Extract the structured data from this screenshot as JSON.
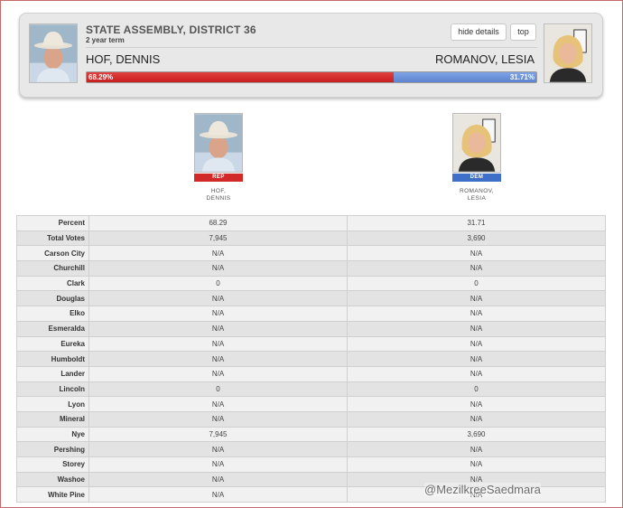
{
  "race": {
    "title": "STATE ASSEMBLY, DISTRICT 36",
    "term": "2 year term",
    "hide_details_label": "hide details",
    "top_label": "top"
  },
  "candidates": {
    "rep": {
      "name": "HOF, DENNIS",
      "name_line1": "HOF,",
      "name_line2": "DENNIS",
      "party": "REP",
      "percent": 68.29,
      "percent_label": "68.29%",
      "color": "#c71f1f"
    },
    "dem": {
      "name": "ROMANOV, LESIA",
      "name_line1": "ROMANOV,",
      "name_line2": "LESIA",
      "party": "DEM",
      "percent": 31.71,
      "percent_label": "31.71%",
      "color": "#5c84cf"
    }
  },
  "table": {
    "rows": [
      {
        "label": "Percent",
        "rep": "68.29",
        "dem": "31.71"
      },
      {
        "label": "Total Votes",
        "rep": "7,945",
        "dem": "3,690"
      },
      {
        "label": "Carson City",
        "rep": "N/A",
        "dem": "N/A"
      },
      {
        "label": "Churchill",
        "rep": "N/A",
        "dem": "N/A"
      },
      {
        "label": "Clark",
        "rep": "0",
        "dem": "0"
      },
      {
        "label": "Douglas",
        "rep": "N/A",
        "dem": "N/A"
      },
      {
        "label": "Elko",
        "rep": "N/A",
        "dem": "N/A"
      },
      {
        "label": "Esmeralda",
        "rep": "N/A",
        "dem": "N/A"
      },
      {
        "label": "Eureka",
        "rep": "N/A",
        "dem": "N/A"
      },
      {
        "label": "Humboldt",
        "rep": "N/A",
        "dem": "N/A"
      },
      {
        "label": "Lander",
        "rep": "N/A",
        "dem": "N/A"
      },
      {
        "label": "Lincoln",
        "rep": "0",
        "dem": "0"
      },
      {
        "label": "Lyon",
        "rep": "N/A",
        "dem": "N/A"
      },
      {
        "label": "Mineral",
        "rep": "N/A",
        "dem": "N/A"
      },
      {
        "label": "Nye",
        "rep": "7,945",
        "dem": "3,690"
      },
      {
        "label": "Pershing",
        "rep": "N/A",
        "dem": "N/A"
      },
      {
        "label": "Storey",
        "rep": "N/A",
        "dem": "N/A"
      },
      {
        "label": "Washoe",
        "rep": "N/A",
        "dem": "N/A"
      },
      {
        "label": "White Pine",
        "rep": "N/A",
        "dem": "N/A"
      }
    ]
  },
  "watermark": "@MezilkreeSaedmara"
}
